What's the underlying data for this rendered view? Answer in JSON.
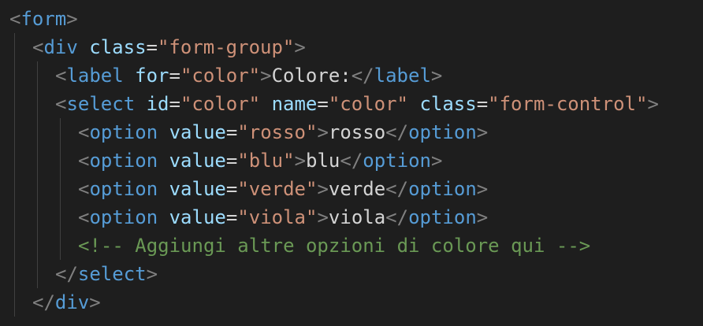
{
  "editor": {
    "lines": [
      {
        "indent": 0,
        "tokens": [
          {
            "t": "<",
            "c": "bracket"
          },
          {
            "t": "form",
            "c": "tag"
          },
          {
            "t": ">",
            "c": "bracket"
          }
        ]
      },
      {
        "indent": 1,
        "tokens": [
          {
            "t": "<",
            "c": "bracket"
          },
          {
            "t": "div",
            "c": "tag"
          },
          {
            "t": " ",
            "c": "text"
          },
          {
            "t": "class",
            "c": "attr"
          },
          {
            "t": "=",
            "c": "eq"
          },
          {
            "t": "\"form-group\"",
            "c": "str"
          },
          {
            "t": ">",
            "c": "bracket"
          }
        ]
      },
      {
        "indent": 2,
        "tokens": [
          {
            "t": "<",
            "c": "bracket"
          },
          {
            "t": "label",
            "c": "tag"
          },
          {
            "t": " ",
            "c": "text"
          },
          {
            "t": "for",
            "c": "attr"
          },
          {
            "t": "=",
            "c": "eq"
          },
          {
            "t": "\"color\"",
            "c": "str"
          },
          {
            "t": ">",
            "c": "bracket"
          },
          {
            "t": "Colore:",
            "c": "text"
          },
          {
            "t": "</",
            "c": "bracket"
          },
          {
            "t": "label",
            "c": "tag"
          },
          {
            "t": ">",
            "c": "bracket"
          }
        ]
      },
      {
        "indent": 2,
        "tokens": [
          {
            "t": "<",
            "c": "bracket"
          },
          {
            "t": "select",
            "c": "tag"
          },
          {
            "t": " ",
            "c": "text"
          },
          {
            "t": "id",
            "c": "attr"
          },
          {
            "t": "=",
            "c": "eq"
          },
          {
            "t": "\"color\"",
            "c": "str"
          },
          {
            "t": " ",
            "c": "text"
          },
          {
            "t": "name",
            "c": "attr"
          },
          {
            "t": "=",
            "c": "eq"
          },
          {
            "t": "\"color\"",
            "c": "str"
          },
          {
            "t": " ",
            "c": "text"
          },
          {
            "t": "class",
            "c": "attr"
          },
          {
            "t": "=",
            "c": "eq"
          },
          {
            "t": "\"form-control\"",
            "c": "str"
          },
          {
            "t": ">",
            "c": "bracket"
          }
        ]
      },
      {
        "indent": 3,
        "tokens": [
          {
            "t": "<",
            "c": "bracket"
          },
          {
            "t": "option",
            "c": "tag"
          },
          {
            "t": " ",
            "c": "text"
          },
          {
            "t": "value",
            "c": "attr"
          },
          {
            "t": "=",
            "c": "eq"
          },
          {
            "t": "\"rosso\"",
            "c": "str"
          },
          {
            "t": ">",
            "c": "bracket"
          },
          {
            "t": "rosso",
            "c": "text"
          },
          {
            "t": "</",
            "c": "bracket"
          },
          {
            "t": "option",
            "c": "tag"
          },
          {
            "t": ">",
            "c": "bracket"
          }
        ]
      },
      {
        "indent": 3,
        "tokens": [
          {
            "t": "<",
            "c": "bracket"
          },
          {
            "t": "option",
            "c": "tag"
          },
          {
            "t": " ",
            "c": "text"
          },
          {
            "t": "value",
            "c": "attr"
          },
          {
            "t": "=",
            "c": "eq"
          },
          {
            "t": "\"blu\"",
            "c": "str"
          },
          {
            "t": ">",
            "c": "bracket"
          },
          {
            "t": "blu",
            "c": "text"
          },
          {
            "t": "</",
            "c": "bracket"
          },
          {
            "t": "option",
            "c": "tag"
          },
          {
            "t": ">",
            "c": "bracket"
          }
        ]
      },
      {
        "indent": 3,
        "tokens": [
          {
            "t": "<",
            "c": "bracket"
          },
          {
            "t": "option",
            "c": "tag"
          },
          {
            "t": " ",
            "c": "text"
          },
          {
            "t": "value",
            "c": "attr"
          },
          {
            "t": "=",
            "c": "eq"
          },
          {
            "t": "\"verde\"",
            "c": "str"
          },
          {
            "t": ">",
            "c": "bracket"
          },
          {
            "t": "verde",
            "c": "text"
          },
          {
            "t": "</",
            "c": "bracket"
          },
          {
            "t": "option",
            "c": "tag"
          },
          {
            "t": ">",
            "c": "bracket"
          }
        ]
      },
      {
        "indent": 3,
        "tokens": [
          {
            "t": "<",
            "c": "bracket"
          },
          {
            "t": "option",
            "c": "tag"
          },
          {
            "t": " ",
            "c": "text"
          },
          {
            "t": "value",
            "c": "attr"
          },
          {
            "t": "=",
            "c": "eq"
          },
          {
            "t": "\"viola\"",
            "c": "str"
          },
          {
            "t": ">",
            "c": "bracket"
          },
          {
            "t": "viola",
            "c": "text"
          },
          {
            "t": "</",
            "c": "bracket"
          },
          {
            "t": "option",
            "c": "tag"
          },
          {
            "t": ">",
            "c": "bracket"
          }
        ]
      },
      {
        "indent": 3,
        "tokens": [
          {
            "t": "<!-- Aggiungi altre opzioni di colore qui -->",
            "c": "comment"
          }
        ]
      },
      {
        "indent": 2,
        "tokens": [
          {
            "t": "</",
            "c": "bracket"
          },
          {
            "t": "select",
            "c": "tag"
          },
          {
            "t": ">",
            "c": "bracket"
          }
        ]
      },
      {
        "indent": 1,
        "tokens": [
          {
            "t": "</",
            "c": "bracket"
          },
          {
            "t": "div",
            "c": "tag"
          },
          {
            "t": ">",
            "c": "bracket"
          }
        ]
      }
    ]
  },
  "colors": {
    "background": "#1e1e1e",
    "bracket": "#808080",
    "tag": "#569cd6",
    "attr": "#9cdcfe",
    "string": "#ce9178",
    "text": "#d4d4d4",
    "comment": "#6a9955",
    "indent_guide": "#404040"
  }
}
